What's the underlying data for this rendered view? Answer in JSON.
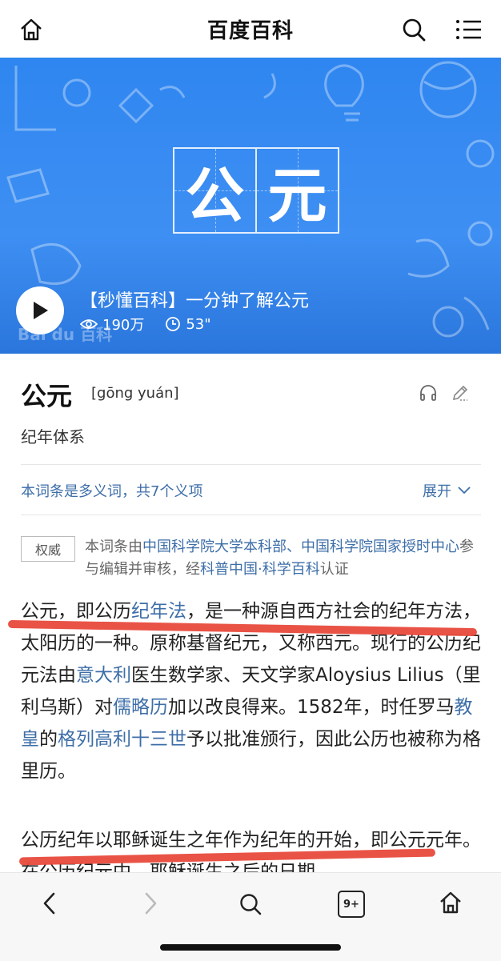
{
  "header": {
    "title": "百度百科",
    "home_icon": "home-icon",
    "search_icon": "search-icon",
    "menu_icon": "menu-icon"
  },
  "hero": {
    "big_chars": [
      "公",
      "元"
    ],
    "video_title": "【秒懂百科】一分钟了解公元",
    "views": "190万",
    "duration": "53\"",
    "watermark": "Bai du 百科",
    "colors": {
      "background": "#3a8cf1"
    }
  },
  "entry": {
    "title": "公元",
    "pinyin": "[gōng yuán]",
    "subtitle": "纪年体系",
    "polysemy_text": "本词条是多义词，共7个义项",
    "expand_label": "展开",
    "authority_badge": "权威",
    "authority_parts": {
      "p1": "本词条由",
      "l1": "中国科学院大学本科部、中国科学院国家授时中心",
      "p2": "参与编辑并审核，经",
      "l2": "科普中国·科学百科",
      "p3": "认证"
    }
  },
  "body": {
    "para1": {
      "t1": "公元，即公历",
      "l1": "纪年法",
      "t2": "，是一种源自西方社会的纪年方法，太阳历的一种。原称基督纪元，又称西元。现行的公历纪元法由",
      "l2": "意大利",
      "t3": "医生数学家、天文学家Aloysius Lilius（里利乌斯）对",
      "l3": "儒略历",
      "t4": "加以改良得来。1582年，时任罗马",
      "l4": "教皇",
      "t5": "的",
      "l5": "格列高利十三世",
      "t6": "予以批准颁行，因此公历也被称为格里历。"
    },
    "para2": "公历纪年以耶稣诞生之年作为纪年的开始，即公元元年。在公历纪元中，耶稣诞生之后的日期"
  },
  "toolbar": {
    "back_icon": "back-icon",
    "forward_icon": "forward-icon",
    "search_icon": "search-icon",
    "tabs_label": "9+",
    "home_icon": "home-icon"
  },
  "colors": {
    "link": "#3d6ea8",
    "highlight": "#e84a3c"
  }
}
